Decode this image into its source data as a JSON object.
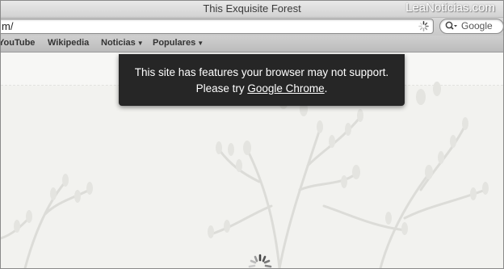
{
  "window": {
    "title": "This Exquisite Forest"
  },
  "watermark": "LeaNoticias.com",
  "toolbar": {
    "address_value": "m/",
    "search_placeholder": "Google"
  },
  "bookmarks": {
    "items": [
      {
        "label": "YouTube",
        "dropdown": false
      },
      {
        "label": "Wikipedia",
        "dropdown": false
      },
      {
        "label": "Noticias",
        "dropdown": true
      },
      {
        "label": "Populares",
        "dropdown": true
      }
    ]
  },
  "notice": {
    "line1": "This site has features your browser may not support.",
    "line2_prefix": "Please try ",
    "link_text": "Google Chrome",
    "line2_suffix": "."
  },
  "icons": {
    "address_spinner": "loading-spinner-icon",
    "search": "search-magnifier-icon",
    "page_loader": "page-loading-spinner-icon",
    "dropdown": "triangle-down-icon"
  },
  "colors": {
    "notice_bg": "#262626",
    "notice_text": "#ffffff",
    "page_bg": "#f2f2ef"
  }
}
